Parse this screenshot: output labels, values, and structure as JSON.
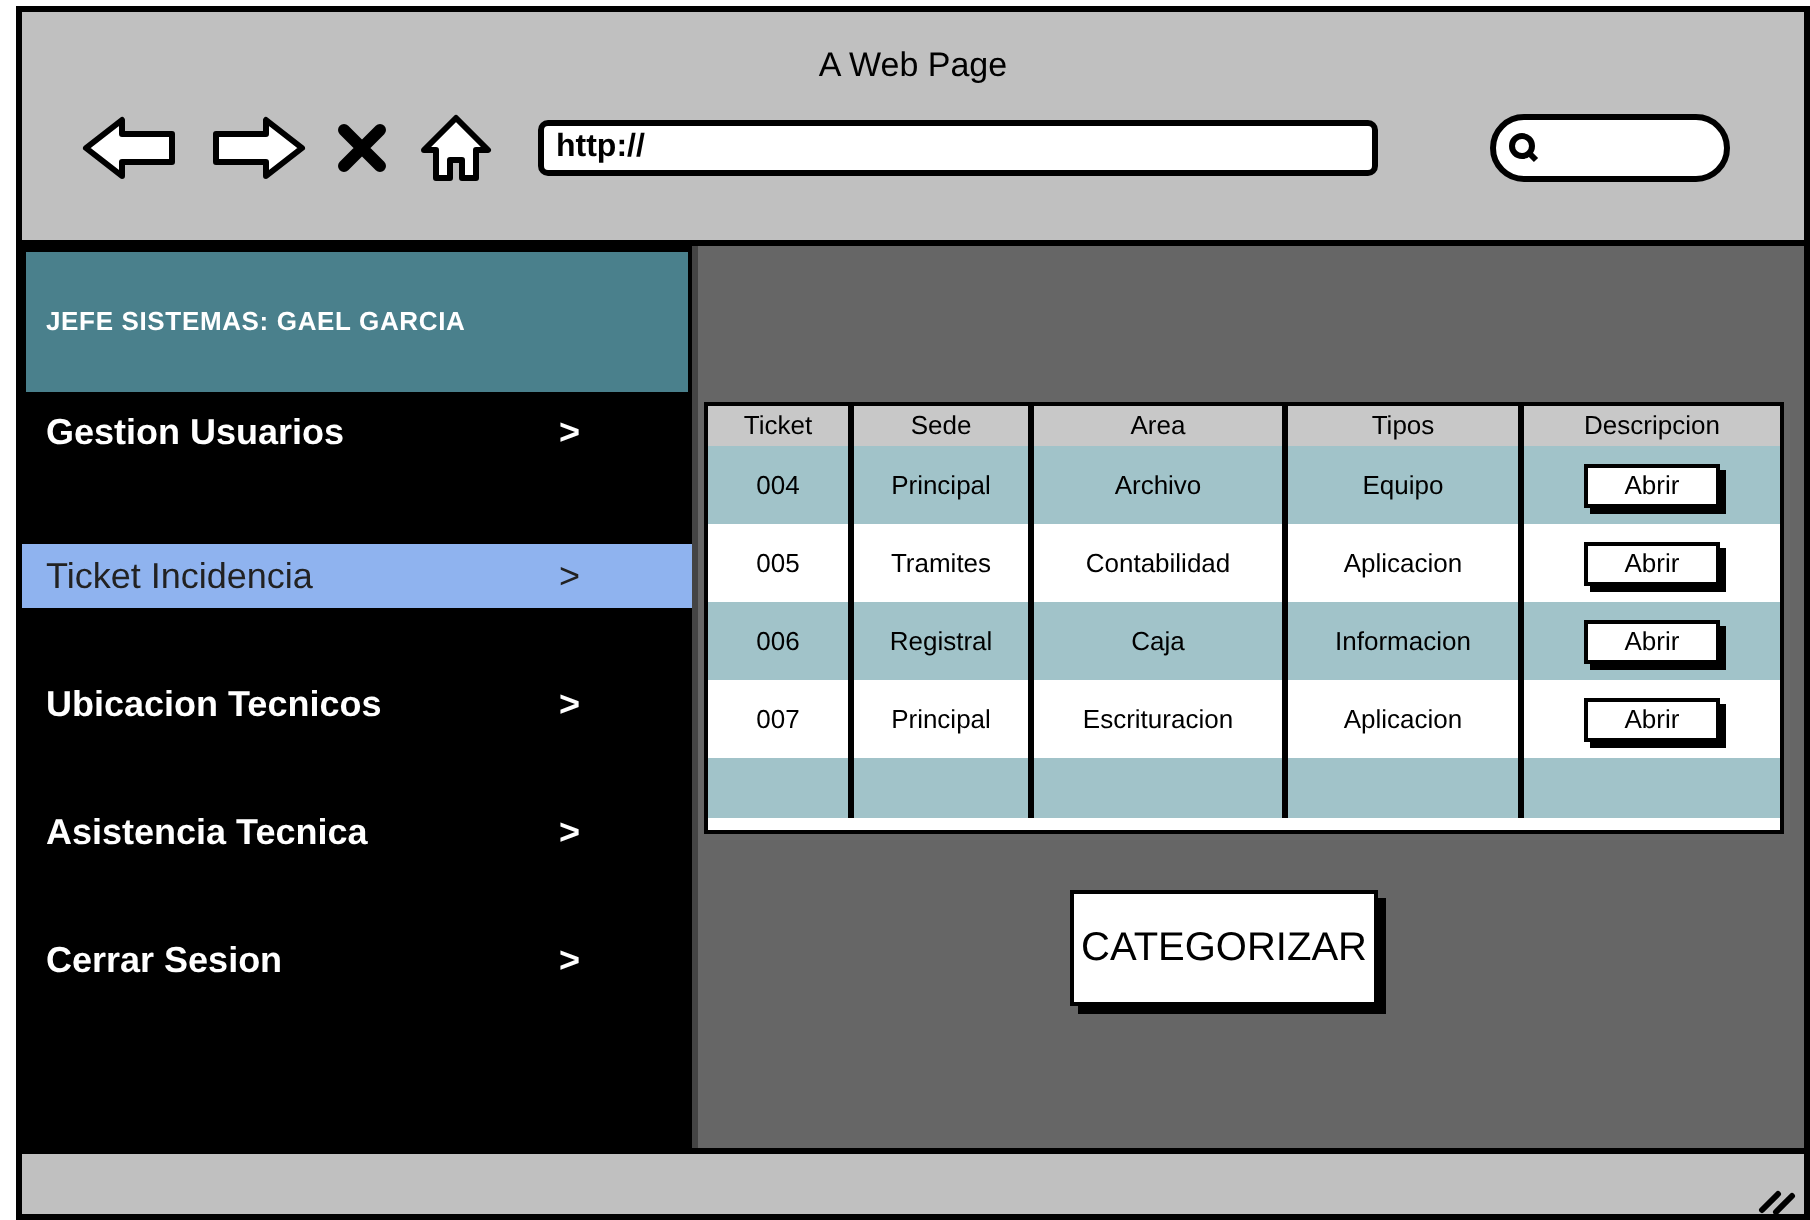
{
  "window": {
    "title": "A Web Page"
  },
  "address_bar": {
    "value": "http://"
  },
  "sidebar": {
    "header": "JEFE SISTEMAS: GAEL GARCIA",
    "items": [
      {
        "label": "Gestion Usuarios",
        "arrow": ">",
        "selected": false
      },
      {
        "label": "Ticket Incidencia",
        "arrow": ">",
        "selected": true
      },
      {
        "label": "Ubicacion Tecnicos",
        "arrow": ">",
        "selected": false
      },
      {
        "label": "Asistencia Tecnica",
        "arrow": ">",
        "selected": false
      },
      {
        "label": "Cerrar Sesion",
        "arrow": ">",
        "selected": false
      }
    ]
  },
  "table": {
    "columns": [
      "Ticket",
      "Sede",
      "Area",
      "Tipos",
      "Descripcion"
    ],
    "rows": [
      {
        "cells": [
          "004",
          "Principal",
          "Archivo",
          "Equipo"
        ],
        "action": "Abrir"
      },
      {
        "cells": [
          "005",
          "Tramites",
          "Contabilidad",
          "Aplicacion"
        ],
        "action": "Abrir"
      },
      {
        "cells": [
          "006",
          "Registral",
          "Caja",
          "Informacion"
        ],
        "action": "Abrir"
      },
      {
        "cells": [
          "007",
          "Principal",
          "Escrituracion",
          "Aplicacion"
        ],
        "action": "Abrir"
      }
    ]
  },
  "categorize_button": "CATEGORIZAR"
}
